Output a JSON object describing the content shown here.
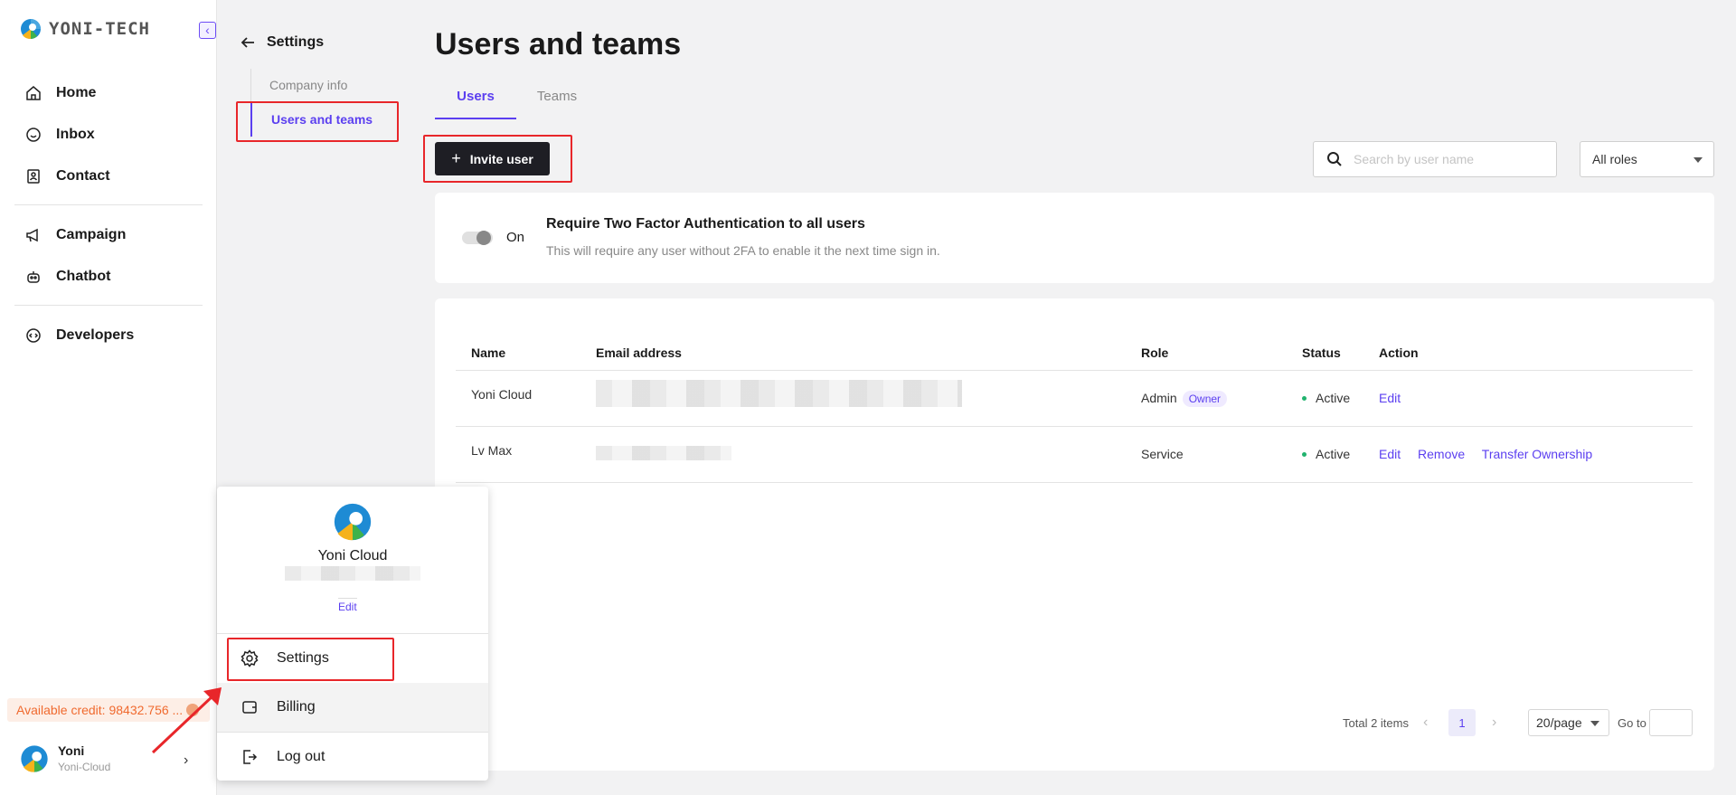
{
  "brand": {
    "name": "YONI-TECH"
  },
  "sidebar": {
    "items": [
      {
        "label": "Home",
        "icon": "home-icon"
      },
      {
        "label": "Inbox",
        "icon": "chat-icon"
      },
      {
        "label": "Contact",
        "icon": "contact-icon"
      },
      {
        "label": "Campaign",
        "icon": "megaphone-icon"
      },
      {
        "label": "Chatbot",
        "icon": "robot-icon"
      },
      {
        "label": "Developers",
        "icon": "code-icon"
      }
    ],
    "credit": "Available credit: 98432.756 ...",
    "user": {
      "name": "Yoni",
      "org": "Yoni-Cloud"
    }
  },
  "settings_nav": {
    "title": "Settings",
    "items": [
      {
        "label": "Company info"
      },
      {
        "label": "Users and teams"
      }
    ]
  },
  "main": {
    "title": "Users and teams",
    "tabs": [
      {
        "label": "Users"
      },
      {
        "label": "Teams"
      }
    ],
    "invite_label": "Invite user",
    "search_placeholder": "Search by user name",
    "role_filter": "All roles",
    "twofa": {
      "toggle_label": "On",
      "title": "Require Two Factor Authentication to all users",
      "description": "This will require any user without 2FA to enable it the next time sign in."
    },
    "table": {
      "columns": [
        "Name",
        "Email address",
        "Role",
        "Status",
        "Action"
      ],
      "rows": [
        {
          "name": "Yoni Cloud",
          "role": "Admin",
          "badge": "Owner",
          "status": "Active",
          "actions": [
            "Edit"
          ]
        },
        {
          "name": "Lv Max",
          "role": "Service",
          "badge": "",
          "status": "Active",
          "actions": [
            "Edit",
            "Remove",
            "Transfer Ownership"
          ]
        }
      ]
    },
    "pagination": {
      "total": "Total 2 items",
      "current_page": "1",
      "page_size": "20/page",
      "goto_label": "Go to"
    }
  },
  "popup": {
    "name": "Yoni Cloud",
    "edit_label": "Edit",
    "items": [
      {
        "label": "Settings"
      },
      {
        "label": "Billing"
      },
      {
        "label": "Log out"
      }
    ]
  },
  "colors": {
    "accent": "#5b3ff0",
    "highlight": "#e8262a",
    "success": "#21b36e",
    "credit": "#f06a2f"
  }
}
